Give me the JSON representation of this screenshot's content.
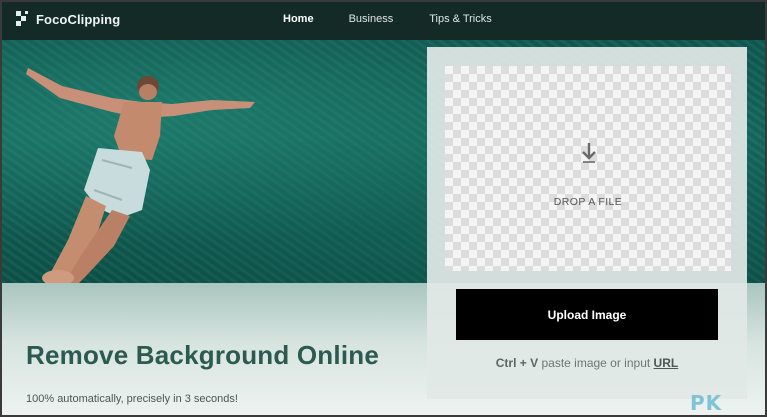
{
  "nav": {
    "brand": "FocoClipping",
    "links": [
      "Home",
      "Business",
      "Tips & Tricks"
    ],
    "active_index": 0
  },
  "hero": {
    "headline": "Remove Background Online",
    "subline": "100% automatically, precisely in 3 seconds!"
  },
  "upload": {
    "drop_text": "DROP A FILE",
    "button_label": "Upload Image",
    "paste_shortcut": "Ctrl + V",
    "paste_text": "paste image or input",
    "url_link": "URL"
  },
  "watermark": "PK",
  "colors": {
    "nav_bg": "#132a27",
    "headline": "#2c5a4f",
    "button_bg": "#000000"
  }
}
